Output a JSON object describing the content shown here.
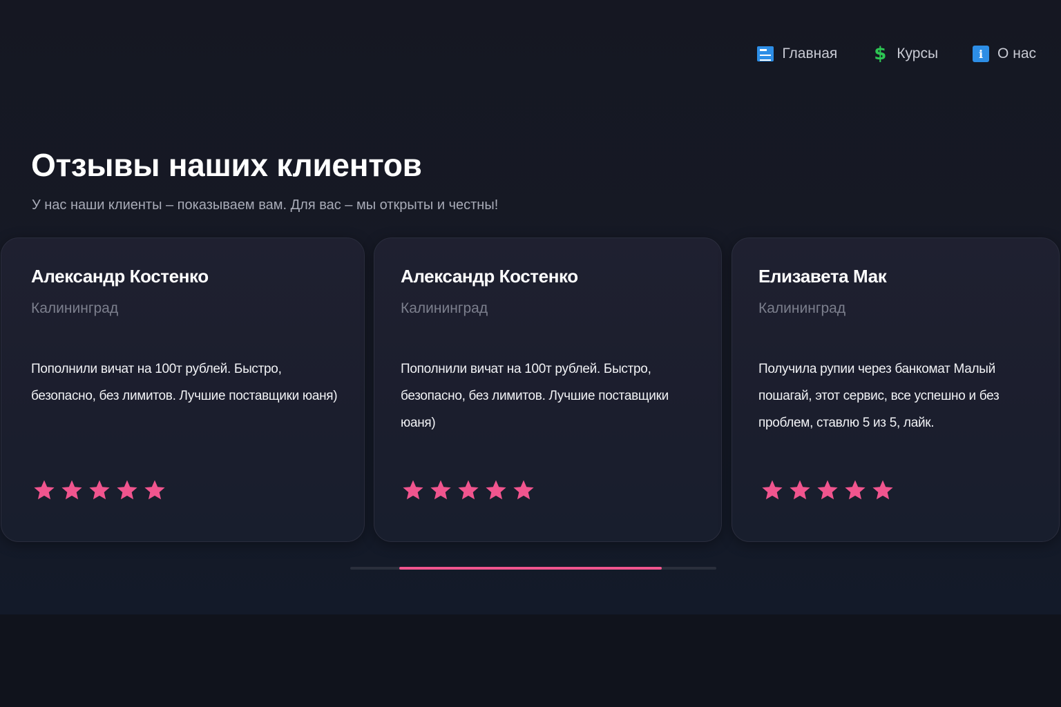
{
  "nav": {
    "items": [
      {
        "label": "Главная",
        "icon": "home-icon"
      },
      {
        "label": "Курсы",
        "icon": "dollar-icon"
      },
      {
        "label": "О нас",
        "icon": "info-icon"
      }
    ]
  },
  "section": {
    "title": "Отзывы наших клиентов",
    "subtitle": "У нас наши клиенты – показываем вам. Для вас – мы открыты и честны!"
  },
  "reviews": [
    {
      "name": "Александр Костенко",
      "city": "Калининград",
      "text": "Пополнили вичат на 100т рублей. Быстро, безопасно, без лимитов. Лучшие поставщики юаня)",
      "rating": 5
    },
    {
      "name": "Александр Костенко",
      "city": "Калининград",
      "text": "Пополнили вичат на 100т рублей. Быстро, безопасно, без лимитов. Лучшие поставщики юаня)",
      "rating": 5
    },
    {
      "name": "Елизавета Мак",
      "city": "Калининград",
      "text": "Получила рупии через банкомат Малый пошагай, этот сервис, все успешно и без проблем, ставлю 5 из 5, лайк.",
      "rating": 5
    }
  ],
  "carousel": {
    "scroll_start": 0.134,
    "scroll_visible": 0.717
  },
  "colors": {
    "accent": "#f0558e",
    "background": "#12141d",
    "card": "#1d1f2e",
    "icon_blue": "#2d8ee6",
    "icon_green": "#2dc653"
  }
}
